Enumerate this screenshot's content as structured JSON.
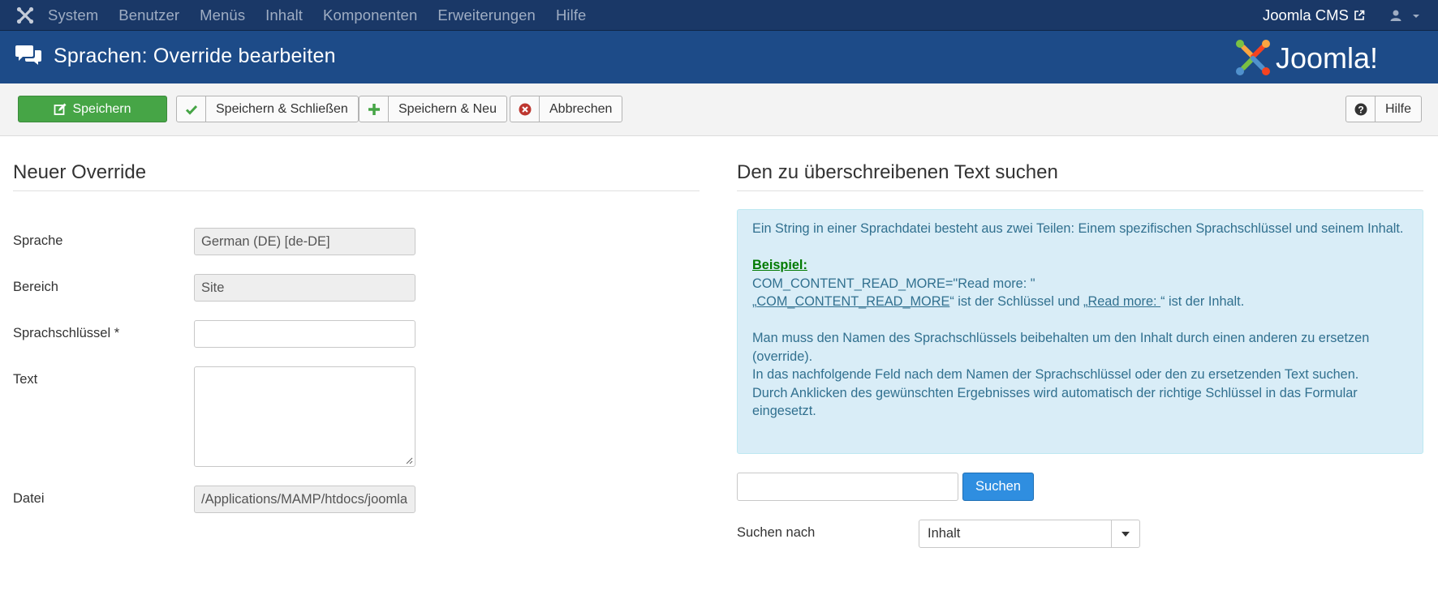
{
  "navbar": {
    "menu": [
      "System",
      "Benutzer",
      "Menüs",
      "Inhalt",
      "Komponenten",
      "Erweiterungen",
      "Hilfe"
    ],
    "site_name": "Joomla CMS",
    "brand_icon": "joomla-icon",
    "user_icon": "user-icon"
  },
  "header": {
    "title": "Sprachen: Override bearbeiten",
    "icon": "comments-icon",
    "logo_text": "Joomla!"
  },
  "toolbar": {
    "save": "Speichern",
    "save_close": "Speichern & Schließen",
    "save_new": "Speichern & Neu",
    "cancel": "Abbrechen",
    "help": "Hilfe"
  },
  "left": {
    "title": "Neuer Override",
    "language_label": "Sprache",
    "language_value": "German (DE) [de-DE]",
    "client_label": "Bereich",
    "client_value": "Site",
    "key_label": "Sprachschlüssel *",
    "key_value": "",
    "text_label": "Text",
    "text_value": "",
    "file_label": "Datei",
    "file_value": "/Applications/MAMP/htdocs/joomla"
  },
  "right": {
    "title": "Den zu überschreibenen Text suchen",
    "info_line1": "Ein String in einer Sprachdatei besteht aus zwei Teilen: Einem spezifischen Sprachschlüssel und seinem Inhalt.",
    "example_label": "Beispiel:",
    "example_code": "COM_CONTENT_READ_MORE=\"Read more: \"",
    "example_open_quote": "„",
    "example_key": "COM_CONTENT_READ_MORE",
    "example_mid": "“ ist der Schlüssel und „",
    "example_value": "Read more: ",
    "example_end": "“ ist der Inhalt.",
    "info_line3": "Man muss den Namen des Sprachschlüssels beibehalten um den Inhalt durch einen anderen zu ersetzen (override).",
    "info_line4": "In das nachfolgende Feld nach dem Namen der Sprachschlüssel oder den zu ersetzenden Text suchen.",
    "info_line5": "Durch Anklicken des gewünschten Ergebnisses wird automatisch der richtige Schlüssel in das Formular eingesetzt.",
    "search_value": "",
    "search_button": "Suchen",
    "search_by_label": "Suchen nach",
    "search_by_value": "Inhalt"
  },
  "colors": {
    "navbar_bg": "#1a3867",
    "header_bg": "#1d4b88",
    "save_green": "#46a546",
    "info_bg": "#d9edf7",
    "info_text": "#31708f",
    "search_blue": "#2f8ee0"
  }
}
